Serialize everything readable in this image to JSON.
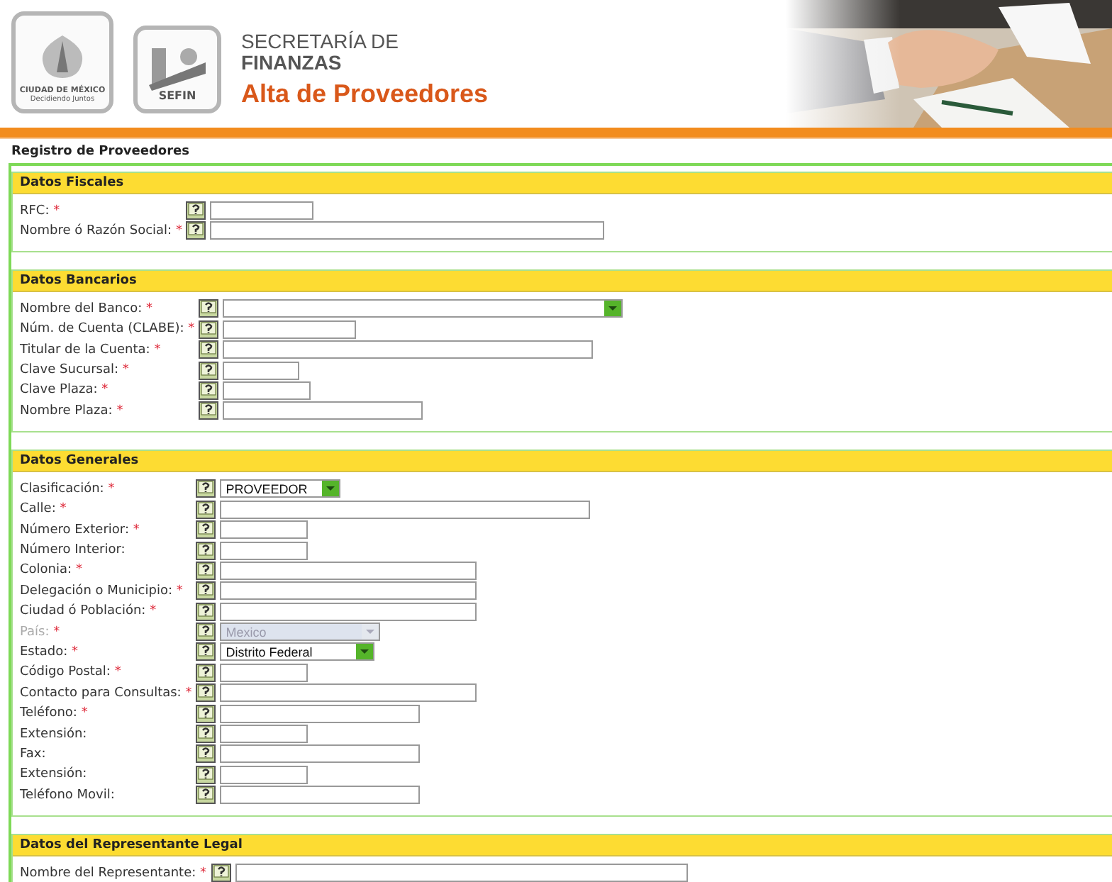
{
  "header": {
    "logo_city": {
      "line1": "CIUDAD DE MÉXICO",
      "line2": "Decidiendo Juntos"
    },
    "logo_sefin": {
      "label": "SEFIN"
    },
    "org_line1": "SECRETARÍA DE",
    "org_line2": "FINANZAS",
    "page_title": "Alta de Proveedores"
  },
  "form_title": "Registro de Proveedores",
  "sections": [
    {
      "title": "Datos Fiscales",
      "fields": [
        {
          "label": "RFC:",
          "mark": "*",
          "kind": "text"
        },
        {
          "label": "Nombre ó Razón Social:",
          "mark": "*",
          "kind": "text"
        }
      ]
    },
    {
      "title": "Datos Bancarios",
      "fields": [
        {
          "label": "Nombre del Banco:",
          "mark": "*",
          "kind": "select"
        },
        {
          "label": "Núm. de Cuenta (CLABE):",
          "mark": "*",
          "kind": "text"
        },
        {
          "label": "Titular de la Cuenta:",
          "mark": "*",
          "kind": "text"
        },
        {
          "label": "Clave Sucursal:",
          "mark": "*",
          "kind": "text"
        },
        {
          "label": "Clave Plaza:",
          "mark": "*",
          "kind": "text"
        },
        {
          "label": "Nombre Plaza:",
          "mark": "*",
          "kind": "text"
        }
      ]
    },
    {
      "title": "Datos Generales",
      "fields": [
        {
          "label": "Clasificación:",
          "mark": "*",
          "kind": "select",
          "value": "PROVEEDOR"
        },
        {
          "label": "Calle:",
          "mark": "*",
          "kind": "text"
        },
        {
          "label": "Número Exterior:",
          "mark": "*",
          "kind": "text"
        },
        {
          "label": "Número Interior:",
          "kind": "text"
        },
        {
          "label": "Colonia:",
          "mark": "*",
          "kind": "text"
        },
        {
          "label": "Delegación o Municipio:",
          "mark": "*",
          "kind": "text"
        },
        {
          "label": "Ciudad ó Población:",
          "mark": "*",
          "kind": "text"
        },
        {
          "label": "País:",
          "mark": "*",
          "kind": "select",
          "value": "Mexico",
          "disabled": true
        },
        {
          "label": "Estado:",
          "mark": "*",
          "kind": "select",
          "value": "Distrito Federal"
        },
        {
          "label": "Código Postal:",
          "mark": "*",
          "kind": "text"
        },
        {
          "label": "Contacto para Consultas:",
          "mark": "*",
          "kind": "text"
        },
        {
          "label": "Teléfono:",
          "mark": "*",
          "kind": "text"
        },
        {
          "label": "Extensión:",
          "kind": "text"
        },
        {
          "label": "Fax:",
          "kind": "text"
        },
        {
          "label": "Extensión:",
          "kind": "text"
        },
        {
          "label": "Teléfono Movil:",
          "kind": "text"
        }
      ]
    },
    {
      "title": "Datos del Representante Legal",
      "fields": [
        {
          "label": "Nombre del Representante:",
          "mark": "*",
          "kind": "text"
        }
      ]
    }
  ]
}
